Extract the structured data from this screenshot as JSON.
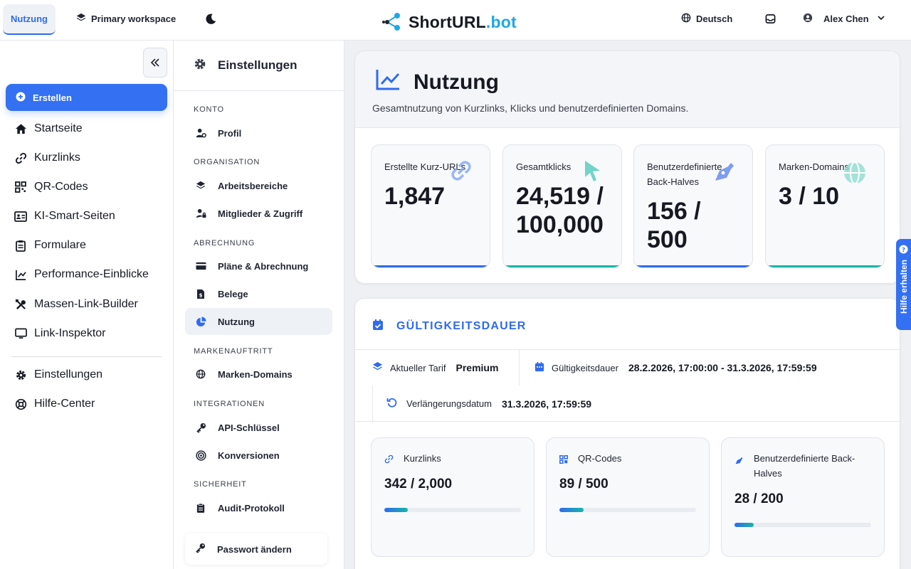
{
  "topbar": {
    "active_tab": "Nutzung",
    "workspace": "Primary workspace",
    "brand_main": "ShortURL",
    "brand_tld": ".bot",
    "language": "Deutsch",
    "user_name": "Alex Chen"
  },
  "sidebar": {
    "create_label": "Erstellen",
    "items": [
      {
        "label": "Startseite",
        "icon": "home-icon"
      },
      {
        "label": "Kurzlinks",
        "icon": "link-icon"
      },
      {
        "label": "QR-Codes",
        "icon": "qr-icon"
      },
      {
        "label": "KI-Smart-Seiten",
        "icon": "id-card-icon"
      },
      {
        "label": "Formulare",
        "icon": "clipboard-icon"
      },
      {
        "label": "Performance-Einblicke",
        "icon": "chart-icon"
      },
      {
        "label": "Massen-Link-Builder",
        "icon": "tools-icon"
      },
      {
        "label": "Link-Inspektor",
        "icon": "monitor-icon"
      }
    ],
    "bottom_items": [
      {
        "label": "Einstellungen",
        "icon": "gear-icon"
      },
      {
        "label": "Hilfe-Center",
        "icon": "lifebuoy-icon"
      }
    ]
  },
  "settings": {
    "title": "Einstellungen",
    "sections": {
      "konto": "KONTO",
      "organisation": "ORGANISATION",
      "abrechnung": "ABRECHNUNG",
      "markenauftritt": "MARKENAUFTRITT",
      "integrationen": "INTEGRATIONEN",
      "sicherheit": "SICHERHEIT"
    },
    "items": {
      "profil": "Profil",
      "arbeitsbereiche": "Arbeitsbereiche",
      "mitglieder": "Mitglieder & Zugriff",
      "plaene": "Pläne & Abrechnung",
      "belege": "Belege",
      "nutzung": "Nutzung",
      "marken_domains": "Marken-Domains",
      "api": "API-Schlüssel",
      "konversionen": "Konversionen",
      "audit": "Audit-Protokoll"
    },
    "password_button": "Passwort ändern"
  },
  "usage": {
    "title": "Nutzung",
    "subtitle": "Gesamtnutzung von Kurzlinks, Klicks und benutzerdefinierten Domains.",
    "stats": [
      {
        "label": "Erstellte Kurz-URLs",
        "value": "1,847",
        "accent": "#2f6bf0"
      },
      {
        "label": "Gesamtklicks",
        "value_line1": "24,519 /",
        "value_line2": "100,000",
        "accent": "#18b5a3"
      },
      {
        "label_line1": "Benutzerdefinierte",
        "label_line2": "Back-Halves",
        "value_line1": "156 /",
        "value_line2": "500",
        "accent": "#2f6bf0"
      },
      {
        "label": "Marken-Domains",
        "value": "3 / 10",
        "accent": "#18b5a3"
      }
    ]
  },
  "validity": {
    "title": "GÜLTIGKEITSDAUER",
    "plan_label": "Aktueller Tarif",
    "plan_value": "Premium",
    "period_label": "Gültigkeitsdauer",
    "period_value": "28.2.2026, 17:00:00 - 31.3.2026, 17:59:59",
    "renewal_label": "Verlängerungsdatum",
    "renewal_value": "31.3.2026, 17:59:59",
    "quotas": [
      {
        "label": "Kurzlinks",
        "value": "342 / 2,000",
        "used": 342,
        "limit": 2000
      },
      {
        "label": "QR-Codes",
        "value": "89 / 500",
        "used": 89,
        "limit": 500
      },
      {
        "label": "Benutzerdefinierte Back-Halves",
        "value": "28 / 200",
        "used": 28,
        "limit": 200
      }
    ]
  },
  "help_tab": "Hilfe erhalten",
  "colors": {
    "accent": "#3370f2",
    "teal": "#18b5a3"
  }
}
